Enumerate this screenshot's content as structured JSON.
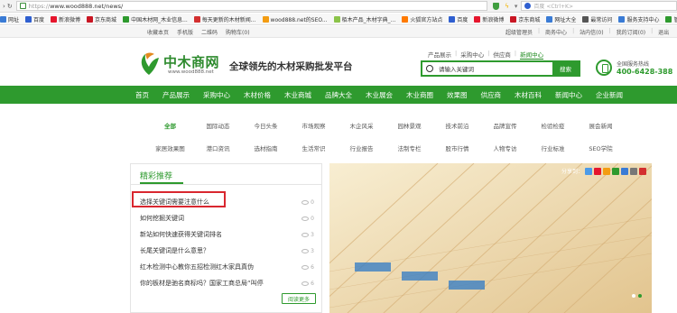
{
  "browser": {
    "url_prefix": "https://",
    "url_host": "www.wood888.net/news/",
    "search_engine_placeholder": "百度 <Ctrl+K>",
    "bookmarks": [
      {
        "label": "网址",
        "color": "#3a7bd5"
      },
      {
        "label": "百度",
        "color": "#2f5fd0"
      },
      {
        "label": "新浪微博",
        "color": "#e6162d"
      },
      {
        "label": "京东商城",
        "color": "#c91623"
      },
      {
        "label": "中国木材网_木业信息...",
        "color": "#2e9a2e"
      },
      {
        "label": "每天更新的木材新闻...",
        "color": "#d32f2f"
      },
      {
        "label": "wood888.net的SEO...",
        "color": "#f39c12"
      },
      {
        "label": "栢木产品_木材字典_...",
        "color": "#8bc34a"
      },
      {
        "label": "火狐官方站点",
        "color": "#ff7a00"
      },
      {
        "label": "百度",
        "color": "#2f5fd0"
      },
      {
        "label": "新浪微博",
        "color": "#e6162d"
      },
      {
        "label": "京东商城",
        "color": "#c91623"
      },
      {
        "label": "网址大全",
        "color": "#3a7bd5"
      },
      {
        "label": "最常访问",
        "color": "#555555"
      },
      {
        "label": "服务支持中心",
        "color": "#3a7bd5"
      },
      {
        "label": "管理中心 - 中木",
        "color": "#2e9a2e"
      }
    ]
  },
  "topbar": {
    "left_links": [
      "收藏本页",
      "手机版",
      "二维码",
      "购物车(0)"
    ],
    "right_links": [
      "超级管理员",
      "商务中心",
      "站内信(0)",
      "我的订阅(0)",
      "退出"
    ]
  },
  "header": {
    "logo_title": "中木商网",
    "logo_domain": "www.wood888.net",
    "slogan": "全球领先的木材采购批发平台",
    "quick_links": [
      "产品展示",
      "采购中心",
      "供应商",
      "新闻中心"
    ],
    "active_quick_link_index": 3,
    "search_placeholder": "请输入关键词",
    "search_button": "搜索",
    "hotline_label": "全国服务热线",
    "hotline_number": "400-6428-388"
  },
  "main_nav": [
    "首页",
    "产品展示",
    "采购中心",
    "木材价格",
    "木业商城",
    "品牌大全",
    "木业展会",
    "木业商圈",
    "效果图",
    "供应商",
    "木材百科",
    "新闻中心",
    "企业新闻"
  ],
  "categories": {
    "row1": [
      "全部",
      "国际动态",
      "今日头条",
      "市场观察",
      "木企风采",
      "园林景观",
      "技术前沿",
      "品牌宣传",
      "检验检疫",
      "展会新闻"
    ],
    "row2": [
      "家居效果图",
      "港口资讯",
      "选材指南",
      "生活常识",
      "行业报告",
      "法制专栏",
      "股市行情",
      "人物专访",
      "行业标准",
      "SEO学院"
    ],
    "active": "全部"
  },
  "feature": {
    "title": "精彩推荐",
    "items": [
      {
        "title": "选择关键词需要注意什么",
        "views": "0"
      },
      {
        "title": "如何挖掘关键词",
        "views": "0"
      },
      {
        "title": "新站如何快速获得关键词排名",
        "views": "3"
      },
      {
        "title": "长尾关键词是什么意思？",
        "views": "3"
      },
      {
        "title": "红木检测中心教你五招检测红木家具真伪",
        "views": "6"
      },
      {
        "title": "你的板材是驰名商标吗？国家工商总局“叫停",
        "views": "6"
      }
    ],
    "more_label": "阅读更多",
    "highlighted_index": 0
  },
  "hero": {
    "share_label": "分享到：",
    "share_colors": [
      "#4c9be8",
      "#e6162d",
      "#f39c12",
      "#2e9a2e",
      "#3a7bd5",
      "#777777",
      "#d32f2f"
    ],
    "slide_count": 2,
    "active_slide": 1
  },
  "colors": {
    "brand_green": "#2e9a2e",
    "highlight_red": "#d9272f"
  }
}
